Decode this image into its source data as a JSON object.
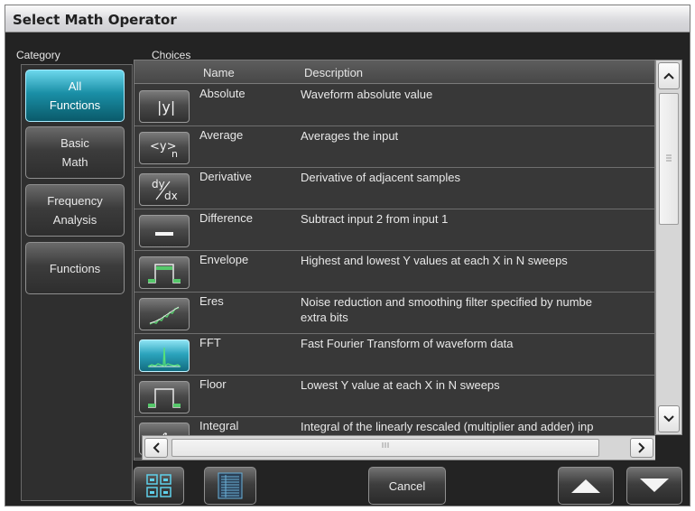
{
  "window": {
    "title": "Select Math Operator"
  },
  "category": {
    "header": "Category",
    "items": [
      {
        "line1": "All",
        "line2": "Functions",
        "active": true
      },
      {
        "line1": "Basic",
        "line2": "Math",
        "active": false
      },
      {
        "line1": "Frequency",
        "line2": "Analysis",
        "active": false
      },
      {
        "line1": "Functions",
        "line2": "",
        "active": false
      }
    ]
  },
  "choices": {
    "header": "Choices",
    "columns": {
      "name": "Name",
      "description": "Description"
    },
    "rows": [
      {
        "name": "Absolute",
        "desc": "Waveform absolute value",
        "desc2": "",
        "icon": "absolute-value-icon",
        "selected": false
      },
      {
        "name": "Average",
        "desc": "Averages the input",
        "desc2": "",
        "icon": "average-icon",
        "selected": false
      },
      {
        "name": "Derivative",
        "desc": "Derivative of adjacent samples",
        "desc2": "",
        "icon": "derivative-icon",
        "selected": false
      },
      {
        "name": "Difference",
        "desc": "Subtract input 2 from input 1",
        "desc2": "",
        "icon": "difference-icon",
        "selected": false
      },
      {
        "name": "Envelope",
        "desc": "Highest and lowest Y values at each X in N sweeps",
        "desc2": "",
        "icon": "envelope-icon",
        "selected": false
      },
      {
        "name": "Eres",
        "desc": "Noise reduction and smoothing filter specified by numbe",
        "desc2": "extra bits",
        "icon": "eres-icon",
        "selected": false
      },
      {
        "name": "FFT",
        "desc": "Fast Fourier Transform of waveform data",
        "desc2": "",
        "icon": "fft-icon",
        "selected": true
      },
      {
        "name": "Floor",
        "desc": "Lowest Y value at each X in N sweeps",
        "desc2": "",
        "icon": "floor-icon",
        "selected": false
      },
      {
        "name": "Integral",
        "desc": "Integral of the linearly rescaled (multiplier and adder) inp",
        "desc2": "",
        "icon": "integral-icon",
        "selected": false
      }
    ]
  },
  "toolbar": {
    "cancel_label": "Cancel",
    "grid_view_icon": "grid-view-icon",
    "list_view_icon": "list-view-icon",
    "up_icon": "triangle-up-icon",
    "down_icon": "triangle-down-icon"
  },
  "colors": {
    "accent": "#1a9bb5",
    "panel": "#383838",
    "background": "#232323"
  }
}
